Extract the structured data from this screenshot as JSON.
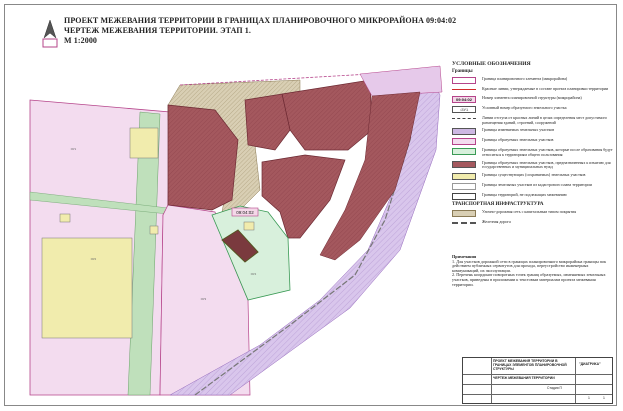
{
  "title": {
    "line1": "ПРОЕКТ МЕЖЕВАНИЯ ТЕРРИТОРИИ В ГРАНИЦАХ ПЛАНИРОВОЧНОГО МИКРОРАЙОНА 09:04:02",
    "line2": "ЧЕРТЕЖ МЕЖЕВАНИЯ ТЕРРИТОРИИ. ЭТАП 1.",
    "line3": "М 1:2000"
  },
  "map": {
    "block_label": "09:04:02",
    "colors": {
      "planned_lot": "#a4585e",
      "garden_zone": "#f3dcef",
      "building": "#f1ecad",
      "public_area": "#d8f0dc",
      "road_pink": "#e6c9ea",
      "green_strip": "#bfe0bb",
      "hatch_road": "#c9b99a"
    }
  },
  "legend": {
    "heading": "УСЛОВНЫЕ ОБОЗНАЧЕНИЯ",
    "boundaries_title": "Границы",
    "items": [
      {
        "code": "",
        "text": "Граница планировочного элемента (микрорайона)"
      },
      {
        "code": "",
        "text": "Красные линии, утверждаемые в составе проекта планировки территории"
      },
      {
        "code": "09:04:02",
        "text": "Номер элемента планировочной структуры (микрорайона)"
      },
      {
        "code": ":ЗУ1",
        "text": "Условный номер образуемого земельного участка"
      },
      {
        "code": "",
        "text": "Линии отступа от красных линий в целях определения мест допустимого размещения зданий, строений, сооружений"
      },
      {
        "code": "",
        "text": "Границы изменяемых земельных участков"
      },
      {
        "code": "",
        "text": "Границы образуемых земельных участков"
      },
      {
        "code": "",
        "text": "Границы образуемых земельных участков, которые после образования будут относиться к территориям общего пользования"
      },
      {
        "code": "",
        "text": "Границы образуемых земельных участков, предназначенных к изъятию для государственных и муниципальных нужд"
      },
      {
        "code": "",
        "text": "Границы существующих (сохраняемых) земельных участков"
      },
      {
        "code": "",
        "text": "Границы земельных участков из кадастрового плана территории"
      },
      {
        "code": "",
        "text": "Границы территорий, не подлежащих межеванию"
      }
    ],
    "transport_title": "ТРАНСПОРТНАЯ ИНФРАСТРУКТУРА",
    "transport_items": [
      {
        "text": "Улично-дорожная сеть с капитальным типом покрытия"
      },
      {
        "text": "Железная дорога"
      }
    ]
  },
  "notes": {
    "heading": "Примечания",
    "items": [
      "1. Для участков дорожной сети в границах планировочного микрорайона границы пок действием публичных сервитутов для прохода, переустройство инженерных коммуникаций, их эксплуатации.",
      "2. Перечень координат поворотных точек границ образуемых, изменяемых земельных участков, приведены в приложении к текстовым материалам проекта межевания территории."
    ]
  },
  "stamp": {
    "org": "ПРОЕКТ МЕЖЕВАНИЯ ТЕРРИТОРИИ В ГРАНИЦАХ ЭЛЕМЕНТОВ ПЛАНИРОВОЧНОЙ СТРУКТУРЫ",
    "company": "\"ДИАТРИКА\"",
    "sheet_title": "ЧЕРТЕЖ МЕЖЕВАНИЯ ТЕРРИТОРИИ",
    "stage": "Стадия П",
    "sheet": "1",
    "sheets": "1"
  }
}
